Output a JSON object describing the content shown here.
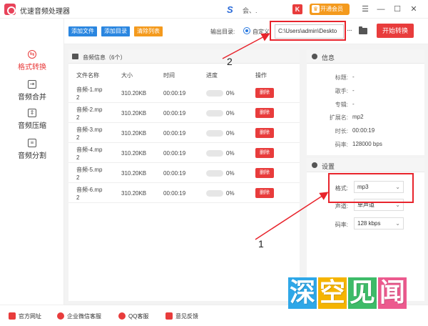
{
  "app": {
    "title": "优速音频处理器",
    "user_name": "会、.",
    "k_badge": "K",
    "vip_label": "开通会员",
    "window_controls": [
      "menu-icon",
      "minimize-icon",
      "maximize-icon",
      "close-icon"
    ]
  },
  "sidebar": {
    "items": [
      {
        "label": "格式转换",
        "icon": "convert-icon",
        "active": true
      },
      {
        "label": "音频合并",
        "icon": "merge-icon",
        "active": false
      },
      {
        "label": "音频压缩",
        "icon": "compress-icon",
        "active": false
      },
      {
        "label": "音频分割",
        "icon": "split-icon",
        "active": false
      }
    ]
  },
  "toolbar": {
    "add_file": "添加文件",
    "add_folder": "添加目录",
    "clear_list": "清除列表",
    "output_label": "输出目录:",
    "custom_option": "自定义",
    "path_value": "C:\\Users\\admin\\Deskto",
    "more": "···",
    "start": "开始转换"
  },
  "audio_panel": {
    "title": "音频信息（6个）",
    "columns": [
      "文件名称",
      "大小",
      "时间",
      "进度",
      "操作"
    ],
    "rows": [
      {
        "name1": "音频-1.mp",
        "name2": "2",
        "size": "310.20KB",
        "time": "00:00:19",
        "progress": "0%",
        "action": "删除"
      },
      {
        "name1": "音频-2.mp",
        "name2": "2",
        "size": "310.20KB",
        "time": "00:00:19",
        "progress": "0%",
        "action": "删除"
      },
      {
        "name1": "音频-3.mp",
        "name2": "2",
        "size": "310.20KB",
        "time": "00:00:19",
        "progress": "0%",
        "action": "删除"
      },
      {
        "name1": "音频-4.mp",
        "name2": "2",
        "size": "310.20KB",
        "time": "00:00:19",
        "progress": "0%",
        "action": "删除"
      },
      {
        "name1": "音频-5.mp",
        "name2": "2",
        "size": "310.20KB",
        "time": "00:00:19",
        "progress": "0%",
        "action": "删除"
      },
      {
        "name1": "音频-6.mp",
        "name2": "2",
        "size": "310.20KB",
        "time": "00:00:19",
        "progress": "0%",
        "action": "删除"
      }
    ]
  },
  "info": {
    "title": "信息",
    "fields": [
      {
        "label": "标题:",
        "value": "-"
      },
      {
        "label": "歌手:",
        "value": "-"
      },
      {
        "label": "专辑:",
        "value": "-"
      },
      {
        "label": "扩展名:",
        "value": "mp2"
      },
      {
        "label": "时长:",
        "value": "00:00:19"
      },
      {
        "label": "码率:",
        "value": "128000 bps"
      }
    ]
  },
  "settings": {
    "title": "设置",
    "format_label": "格式:",
    "format_value": "mp3",
    "channel_label": "声道:",
    "channel_value": "单声道",
    "bitrate_label": "码率:",
    "bitrate_value": "128 kbps"
  },
  "annotations": {
    "label_1": "1",
    "label_2": "2",
    "color": "#e8242c"
  },
  "watermark": {
    "chars": [
      "深",
      "空",
      "见",
      "闻"
    ],
    "colors": [
      "#2ea7e8",
      "#f5b400",
      "#3dbb68",
      "#ec5a8e"
    ]
  },
  "footer": {
    "items": [
      "官方网址",
      "企业微信客服",
      "QQ客服",
      "意见反馈"
    ]
  },
  "colors": {
    "accent": "#e83c3c",
    "btn_blue": "#2a86e0",
    "btn_orange": "#f49a1d"
  }
}
